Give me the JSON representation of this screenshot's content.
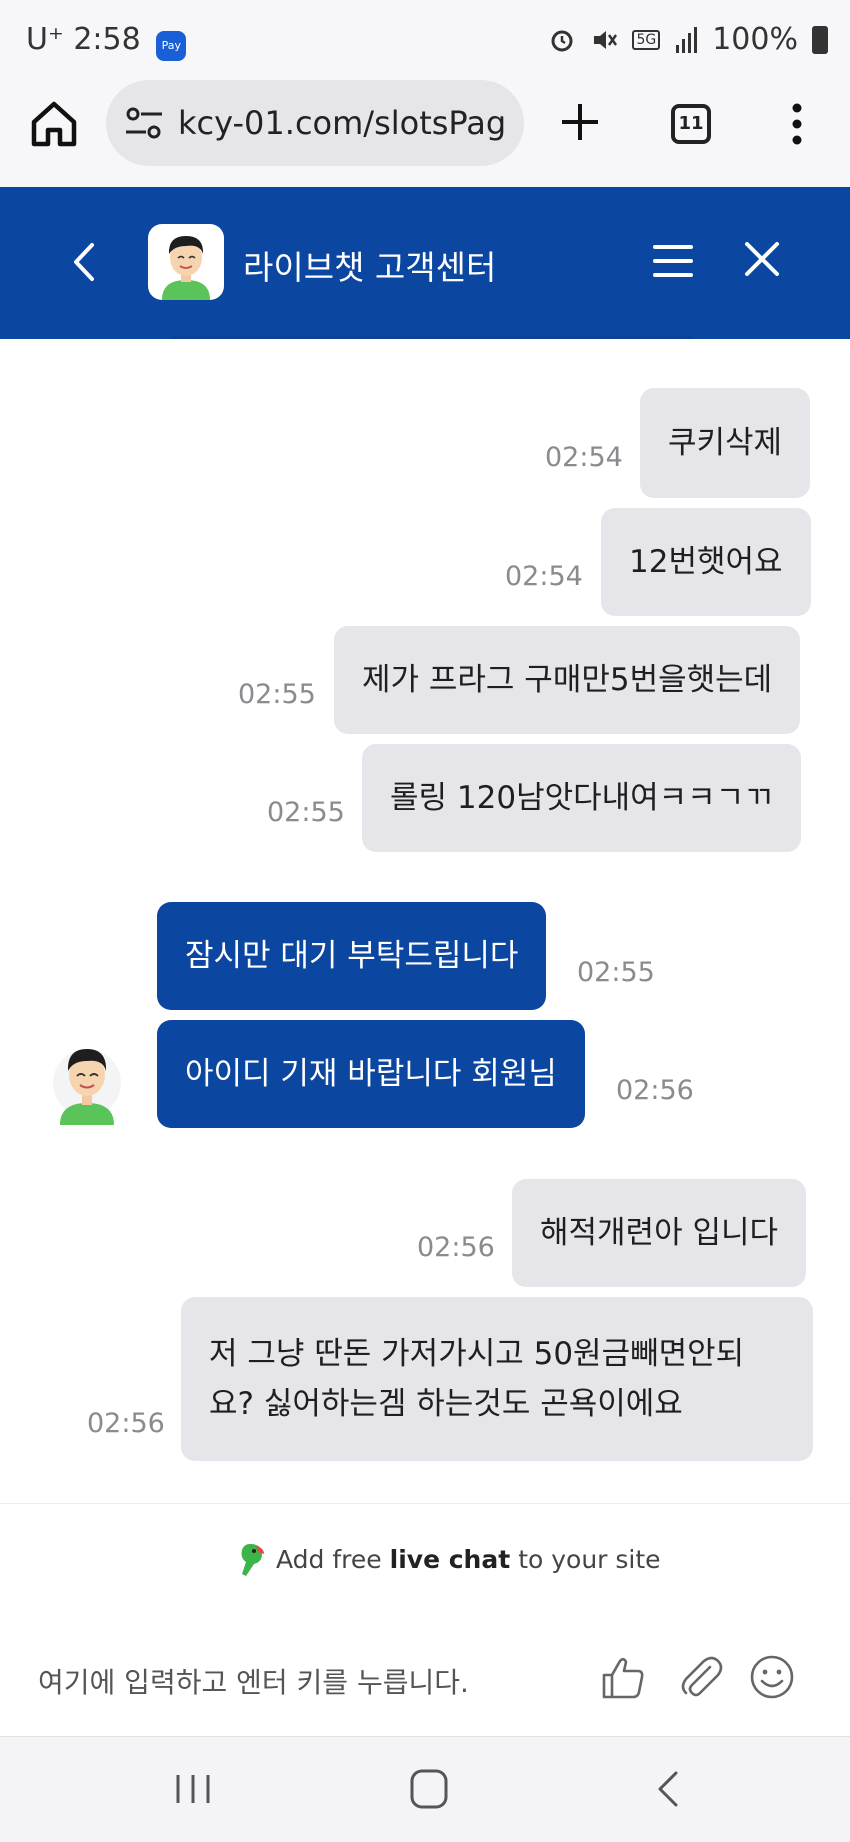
{
  "status_bar": {
    "time": "2:58",
    "carrier": "U⁺",
    "pay_badge": "Pay",
    "battery": "100%",
    "network": "5G"
  },
  "browser": {
    "url": "kcy-01.com/slotsPag",
    "tab_count": "11"
  },
  "chat_header": {
    "title": "라이브챗 고객센터"
  },
  "messages": [
    {
      "sender": "user",
      "text": "쿠키삭제",
      "time": "02:54"
    },
    {
      "sender": "user",
      "text": "12번햇어요",
      "time": "02:54"
    },
    {
      "sender": "user",
      "text": "제가 프라그 구매만5번을햇는데",
      "time": "02:55"
    },
    {
      "sender": "user",
      "text": "롤링 120남앗다내여ㅋㅋㄱㄲ",
      "time": "02:55"
    },
    {
      "sender": "agent",
      "text": "잠시만 대기 부탁드립니다",
      "time": "02:55"
    },
    {
      "sender": "agent",
      "text": "아이디 기재 바랍니다 회원님",
      "time": "02:56"
    },
    {
      "sender": "user",
      "text": "해적개련아 입니다",
      "time": "02:56"
    },
    {
      "sender": "user",
      "text": "저 그냥 딴돈 가저가시고 50원금빼면안되요? 싫어하는겜 하는것도 곤욕이에요",
      "time": "02:56"
    }
  ],
  "branding": {
    "prefix": "Add free",
    "bold": "live chat",
    "suffix": "to your site"
  },
  "input": {
    "placeholder": "여기에 입력하고 엔터 키를 누릅니다."
  },
  "colors": {
    "header": "#0b46a0",
    "agent_bubble": "#0b46a0",
    "user_bubble": "#e5e5ea"
  }
}
